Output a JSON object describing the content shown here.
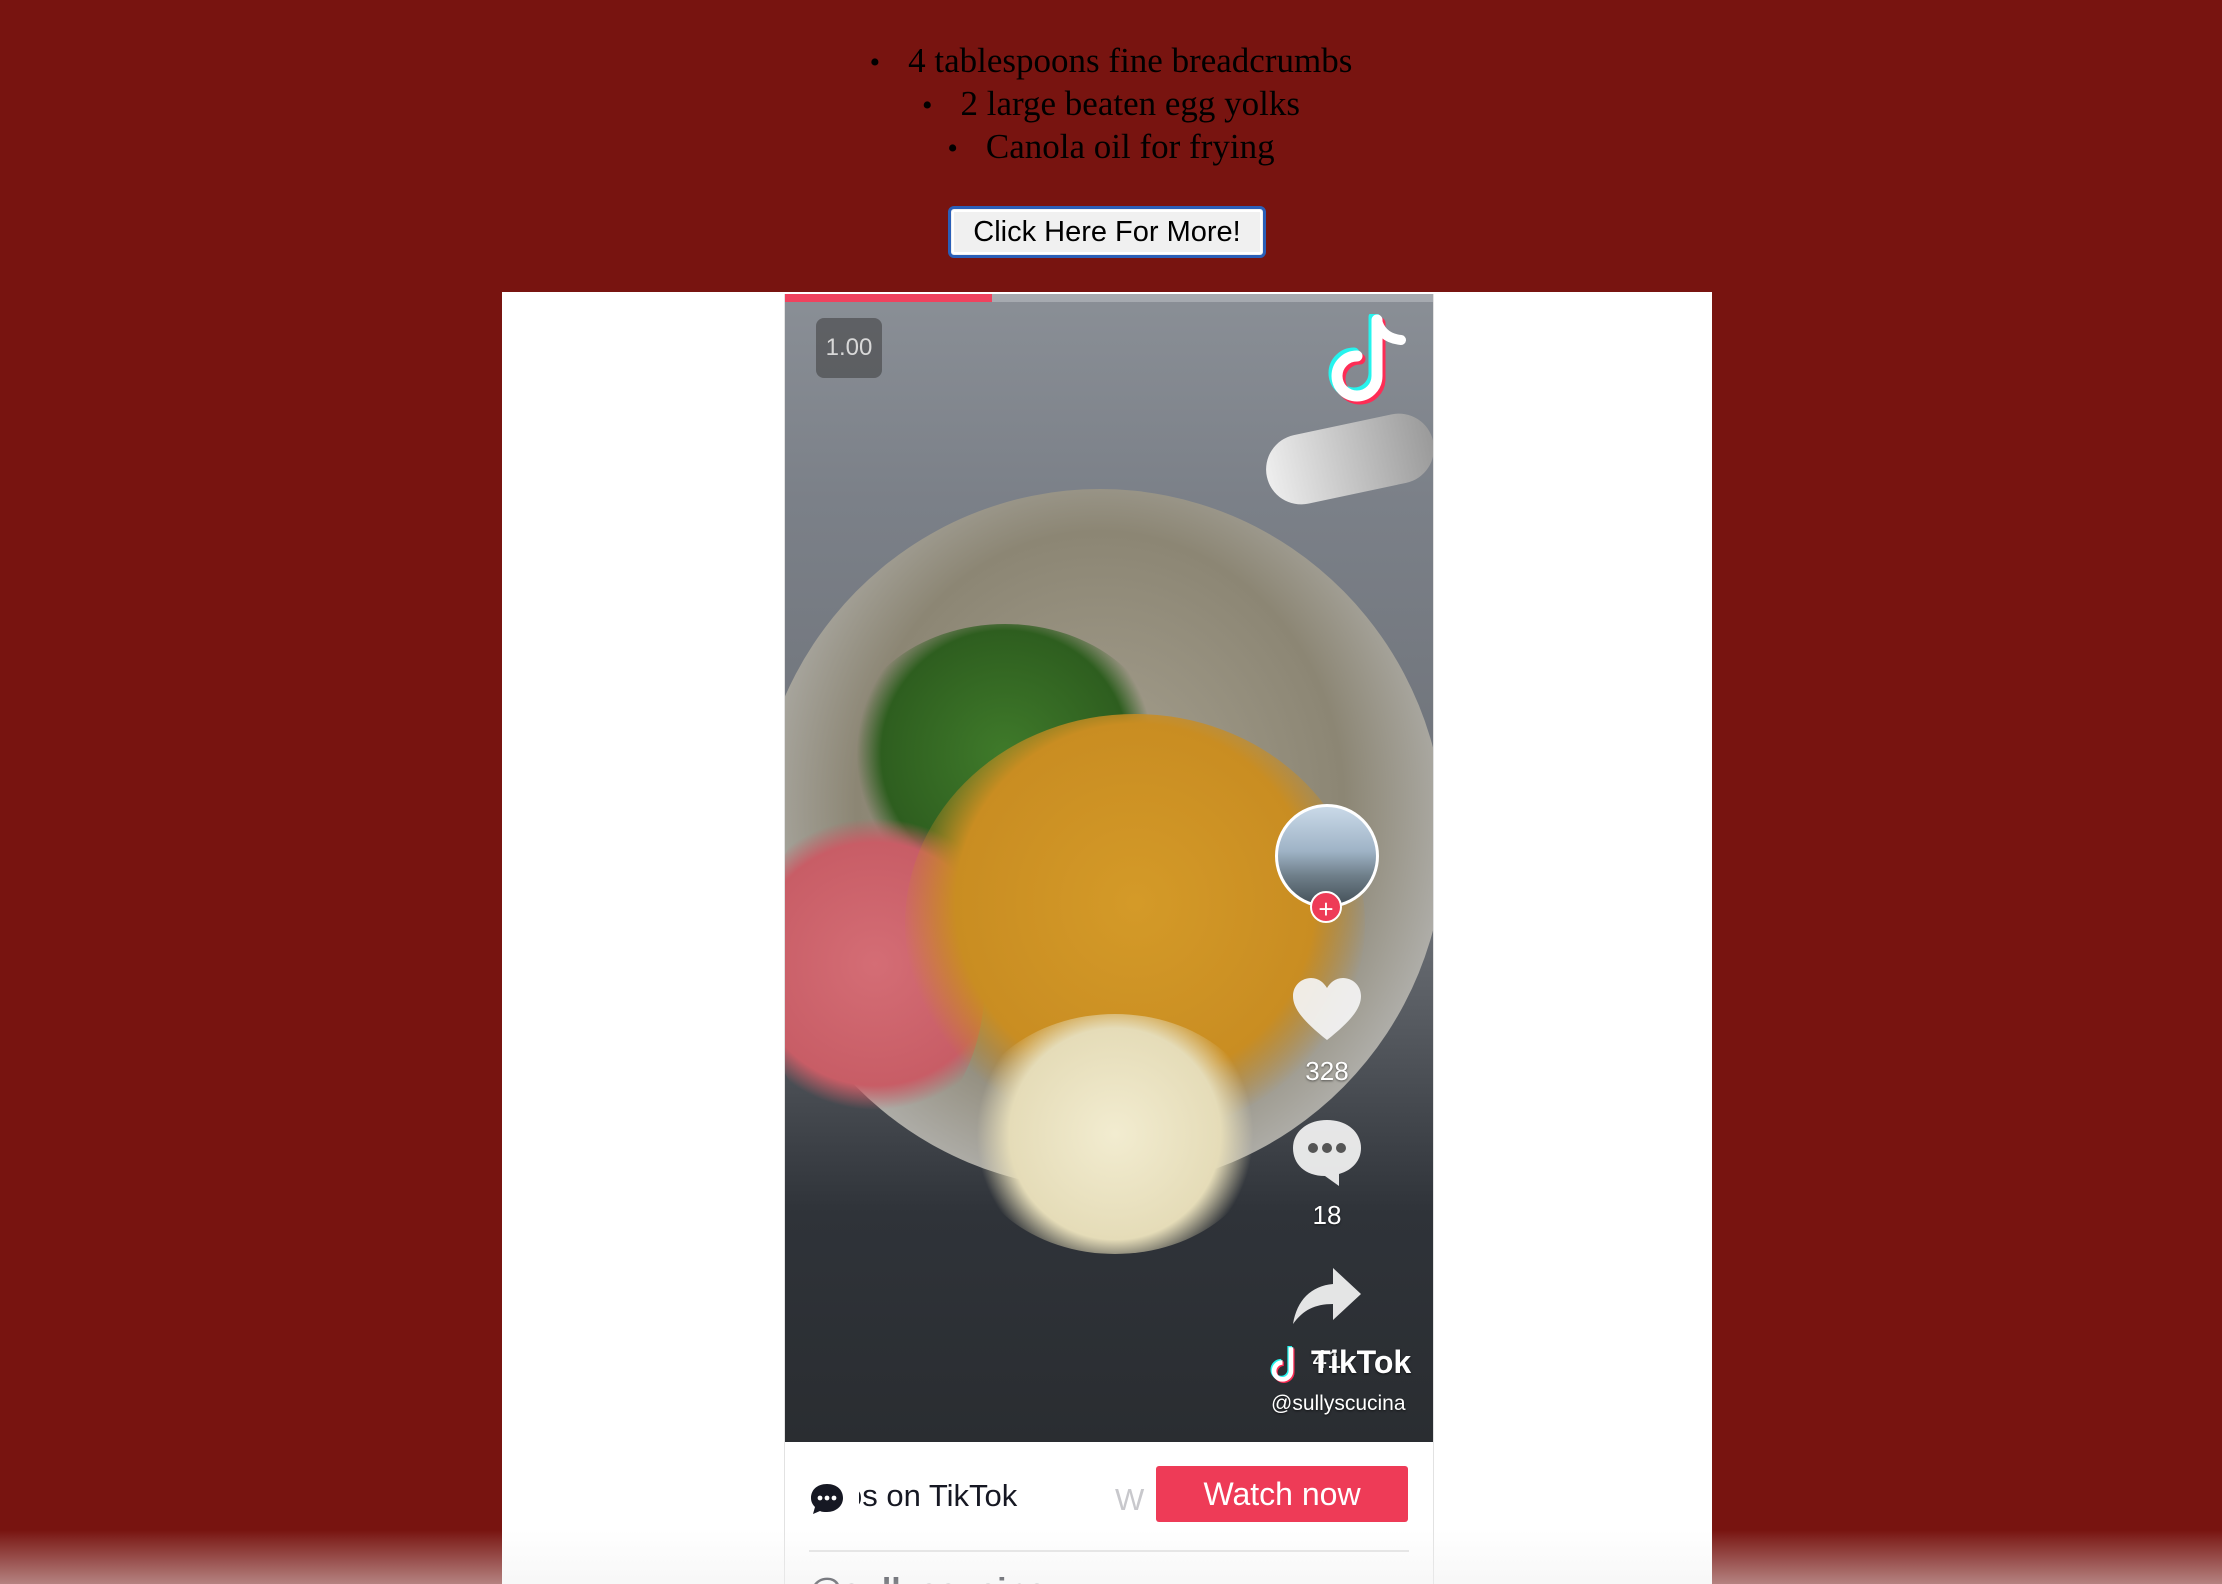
{
  "ingredients": [
    "4 tablespoons fine breadcrumbs",
    "2 large beaten egg yolks",
    "Canola oil for frying"
  ],
  "more_button": "Click Here For More!",
  "player": {
    "playback_speed": "1.00",
    "progress_fraction": 0.32,
    "likes": "328",
    "comments": "18",
    "shares": "41",
    "watermark_word": "TikTok",
    "watermark_handle": "@sullyscucina",
    "marquee_text": "os on TikTok",
    "marquee_text_next": "W",
    "watch_button": "Watch now",
    "author": "@sullyscucina",
    "accent_color": "#ee3b57",
    "icons": [
      "tiktok-logo-icon",
      "heart-icon",
      "comment-icon",
      "share-arrow-icon",
      "chat-bubble-icon"
    ]
  },
  "colors": {
    "page_background": "#781410",
    "embed_background": "#ffffff"
  }
}
